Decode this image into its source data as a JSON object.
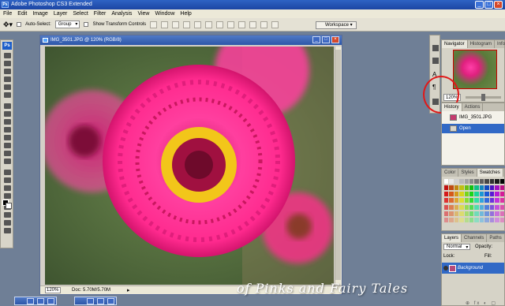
{
  "app": {
    "title": "Adobe Photoshop CS3 Extended"
  },
  "menu": [
    "File",
    "Edit",
    "Image",
    "Layer",
    "Select",
    "Filter",
    "Analysis",
    "View",
    "Window",
    "Help"
  ],
  "options_bar": {
    "auto_select_label": "Auto-Select:",
    "auto_select_value": "Group",
    "show_transform_label": "Show Transform Controls",
    "workspace_label": "Workspace"
  },
  "document": {
    "title": "IMG_3501.JPG @ 120% (RGB/8)",
    "zoom": "120%",
    "doc_size": "Doc: 5.70M/5.70M"
  },
  "panels": {
    "navigator_tabs": [
      "Navigator",
      "Histogram",
      "Info"
    ],
    "navigator_zoom": "120%",
    "history_tabs": [
      "History",
      "Actions"
    ],
    "history_items": [
      "IMG_3501.JPG",
      "Open"
    ],
    "color_tabs": [
      "Color",
      "Styles",
      "Swatches"
    ],
    "layers_tabs": [
      "Layers",
      "Channels",
      "Paths"
    ],
    "blend_mode": "Normal",
    "opacity_label": "Opacity:",
    "lock_label": "Lock:",
    "fill_label": "Fill:",
    "layer_name": "Background"
  },
  "watermark": "of Pinks and Fairy Tales",
  "colors": {
    "accent_annotation": "#e01919",
    "titlebar": "#1c45a3",
    "selected_row": "#3169c6"
  }
}
